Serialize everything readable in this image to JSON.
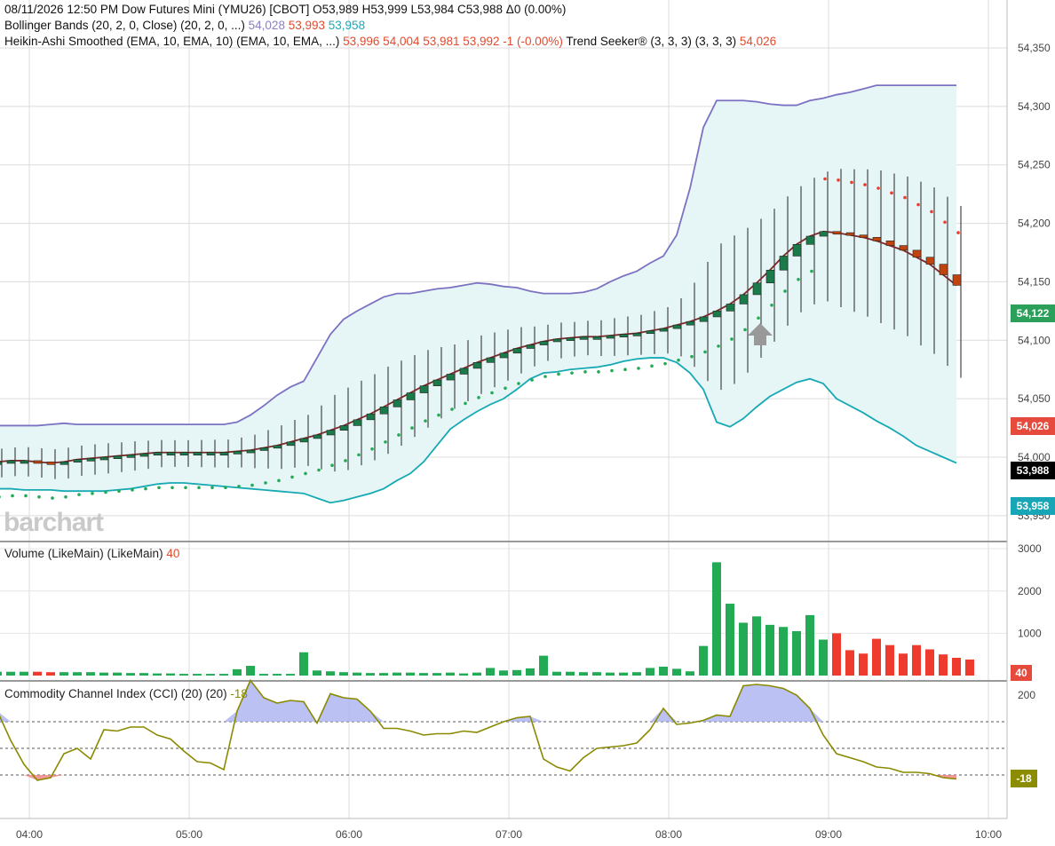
{
  "header": {
    "line1": "08/11/2026  12:50 PM  Dow Futures Mini (YMU26) [CBOT]  O53,989  H53,999  L53,984  C53,988  Δ0 (0.00%)",
    "bb_label": "Bollinger Bands (20, 2, 0, Close)  (20, 2, 0, ...)",
    "bb_upper": "54,028",
    "bb_mid": "53,993",
    "bb_lower": "53,958",
    "ha_label": "Heikin-Ashi Smoothed (EMA, 10, EMA, 10)  (EMA, 10, EMA, ...)",
    "ha_values": "53,996  54,004  53,981  53,992  -1 (-0.00%)",
    "ts_label": "Trend Seeker® (3, 3, 3)  (3, 3, 3)",
    "ts_value": "54,026"
  },
  "watermark": "barchart",
  "price_tags": {
    "green": "54,122",
    "red": "54,026",
    "black": "53,988",
    "teal": "53,958",
    "volume": "40",
    "cci": "-18"
  },
  "volume_pane": {
    "label": "Volume (LikeMain)  (LikeMain)",
    "value": "40"
  },
  "cci_pane": {
    "label": "Commodity Channel Index (CCI) (20)  (20)",
    "value": "-18"
  },
  "colors": {
    "up": "#1a7a4a",
    "down": "#c1440e",
    "bb_upper": "#7b72c2",
    "bb_lower": "#17a9b4",
    "bb_fill": "#e6f6f6",
    "vol_up": "#22aa55",
    "vol_down": "#ee3b2e",
    "cci_line": "#8a8a00",
    "cci_fill": "#aab2f0",
    "cci_neg": "#f08080"
  },
  "chart_data": [
    {
      "type": "line",
      "title": "Dow Futures Mini (YMU26) [CBOT]",
      "x_ticks": [
        "04:00",
        "05:00",
        "06:00",
        "07:00",
        "08:00",
        "09:00",
        "10:00"
      ],
      "y_ticks": [
        53950,
        54000,
        54050,
        54100,
        54150,
        54200,
        54250,
        54300,
        54350
      ],
      "ylim": [
        53930,
        54375
      ],
      "x_start": "03:48",
      "x_step_minutes": 5,
      "series": [
        {
          "name": "Heikin-Ashi Smoothed",
          "values": [
            53996,
            53997,
            53997,
            53996,
            53995,
            53996,
            53998,
            53999,
            54000,
            54001,
            54002,
            54003,
            54004,
            54004,
            54004,
            54004,
            54004,
            54004,
            54005,
            54006,
            54008,
            54010,
            54013,
            54016,
            54019,
            54023,
            54027,
            54032,
            54037,
            54043,
            54049,
            54055,
            54061,
            54066,
            54071,
            54076,
            54081,
            54085,
            54089,
            54093,
            54096,
            54099,
            54101,
            54102,
            54103,
            54103,
            54104,
            54105,
            54106,
            54108,
            54110,
            54113,
            54116,
            54120,
            54125,
            54131,
            54139,
            54149,
            54160,
            54172,
            54182,
            54189,
            54193,
            54192,
            54190,
            54188,
            54185,
            54181,
            54177,
            54171,
            54165,
            54156,
            54147
          ]
        },
        {
          "name": "Bollinger Upper",
          "values": [
            54027,
            54027,
            54027,
            54027,
            54028,
            54029,
            54028,
            54028,
            54028,
            54028,
            54028,
            54028,
            54028,
            54028,
            54028,
            54028,
            54028,
            54028,
            54030,
            54036,
            54044,
            54053,
            54060,
            54065,
            54085,
            54105,
            54118,
            54125,
            54131,
            54137,
            54140,
            54140,
            54142,
            54144,
            54145,
            54147,
            54149,
            54148,
            54146,
            54145,
            54142,
            54140,
            54140,
            54140,
            54141,
            54144,
            54150,
            54155,
            54159,
            54166,
            54172,
            54190,
            54230,
            54282,
            54305,
            54305,
            54305,
            54304,
            54302,
            54301,
            54301,
            54305,
            54307,
            54310,
            54312,
            54315,
            54318,
            54318,
            54318,
            54318,
            54318,
            54318,
            54318
          ]
        },
        {
          "name": "Bollinger Lower",
          "values": [
            53973,
            53973,
            53972,
            53972,
            53972,
            53971,
            53971,
            53971,
            53971,
            53972,
            53973,
            53975,
            53977,
            53978,
            53978,
            53977,
            53976,
            53975,
            53974,
            53973,
            53972,
            53971,
            53970,
            53969,
            53965,
            53961,
            53963,
            53966,
            53969,
            53973,
            53980,
            53986,
            53996,
            54010,
            54024,
            54032,
            54039,
            54045,
            54050,
            54058,
            54067,
            54072,
            54073,
            54075,
            54076,
            54077,
            54079,
            54082,
            54084,
            54085,
            54085,
            54081,
            54072,
            54058,
            54030,
            54026,
            54033,
            54043,
            54052,
            54058,
            54064,
            54067,
            54063,
            54050,
            54044,
            54038,
            54031,
            54025,
            54018,
            54010,
            54005,
            54000,
            53995
          ]
        }
      ]
    },
    {
      "type": "bar",
      "title": "Volume (LikeMain)",
      "y_ticks": [
        1000,
        2000,
        3000
      ],
      "ylim": [
        0,
        3200
      ],
      "series": [
        {
          "name": "Volume",
          "values": [
            90,
            90,
            90,
            90,
            80,
            80,
            80,
            80,
            70,
            70,
            60,
            60,
            50,
            50,
            40,
            40,
            40,
            40,
            150,
            230,
            40,
            40,
            40,
            550,
            120,
            100,
            80,
            70,
            60,
            60,
            70,
            70,
            60,
            60,
            70,
            50,
            70,
            180,
            120,
            130,
            170,
            470,
            90,
            90,
            80,
            80,
            70,
            70,
            80,
            180,
            210,
            160,
            100,
            700,
            2680,
            1700,
            1250,
            1400,
            1200,
            1150,
            1050,
            1430,
            850,
            1000,
            600,
            520,
            870,
            720,
            520,
            720,
            620,
            500,
            420,
            380
          ]
        }
      ]
    },
    {
      "type": "line",
      "title": "Commodity Channel Index (CCI) (20)",
      "y_ticks": [
        200
      ],
      "ylim": [
        -150,
        300
      ],
      "series": [
        {
          "name": "CCI",
          "values": [
            140,
            30,
            -60,
            -120,
            -110,
            -20,
            0,
            -40,
            70,
            65,
            80,
            80,
            50,
            35,
            -10,
            -50,
            -55,
            -80,
            140,
            255,
            190,
            170,
            180,
            175,
            95,
            205,
            190,
            185,
            140,
            75,
            75,
            65,
            50,
            55,
            55,
            65,
            60,
            80,
            100,
            115,
            120,
            -40,
            -70,
            -85,
            -35,
            0,
            5,
            10,
            20,
            70,
            150,
            90,
            95,
            105,
            125,
            120,
            235,
            240,
            235,
            225,
            200,
            150,
            50,
            -20,
            -35,
            -50,
            -70,
            -75,
            -90,
            -90,
            -95,
            -110,
            -115
          ]
        }
      ]
    }
  ]
}
